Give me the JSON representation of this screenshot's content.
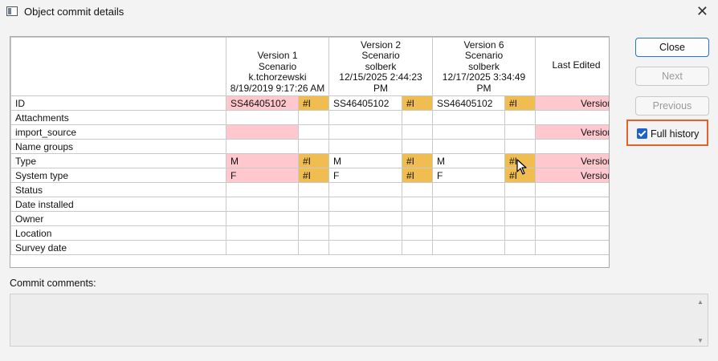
{
  "window": {
    "title": "Object commit details"
  },
  "grid": {
    "columns": [
      {
        "lines": [
          "Version 1",
          "Scenario",
          "k.tchorzewski",
          "8/19/2019 9:17:26 AM"
        ]
      },
      {
        "lines": [
          "Version 2",
          "Scenario",
          "solberk",
          "12/15/2025 2:44:23",
          "PM"
        ]
      },
      {
        "lines": [
          "Version 6",
          "Scenario",
          "solberk",
          "12/17/2025 3:34:49",
          "PM"
        ]
      },
      {
        "lines": [
          "Last Edited"
        ]
      }
    ],
    "rows": [
      {
        "label": "ID",
        "v1": "SS46405102",
        "v1f": "#I",
        "v2": "SS46405102",
        "v2f": "#I",
        "v6": "SS46405102",
        "v6f": "#I",
        "last": "Version"
      },
      {
        "label": "Attachments",
        "v1": "",
        "v1f": "",
        "v2": "",
        "v2f": "",
        "v6": "",
        "v6f": "",
        "last": ""
      },
      {
        "label": "import_source",
        "v1": "",
        "v1f": "",
        "v2": "",
        "v2f": "",
        "v6": "",
        "v6f": "",
        "last": "Version"
      },
      {
        "label": "Name groups",
        "v1": "",
        "v1f": "",
        "v2": "",
        "v2f": "",
        "v6": "",
        "v6f": "",
        "last": ""
      },
      {
        "label": "Type",
        "v1": "M",
        "v1f": "#I",
        "v2": "M",
        "v2f": "#I",
        "v6": "M",
        "v6f": "#I",
        "last": "Version"
      },
      {
        "label": "System type",
        "v1": "F",
        "v1f": "#I",
        "v2": "F",
        "v2f": "#I",
        "v6": "F",
        "v6f": "#I",
        "last": "Version"
      },
      {
        "label": "Status",
        "v1": "",
        "v1f": "",
        "v2": "",
        "v2f": "",
        "v6": "",
        "v6f": "",
        "last": ""
      },
      {
        "label": "Date installed",
        "v1": "",
        "v1f": "",
        "v2": "",
        "v2f": "",
        "v6": "",
        "v6f": "",
        "last": ""
      },
      {
        "label": "Owner",
        "v1": "",
        "v1f": "",
        "v2": "",
        "v2f": "",
        "v6": "",
        "v6f": "",
        "last": ""
      },
      {
        "label": "Location",
        "v1": "",
        "v1f": "",
        "v2": "",
        "v2f": "",
        "v6": "",
        "v6f": "",
        "last": ""
      },
      {
        "label": "Survey date",
        "v1": "",
        "v1f": "",
        "v2": "",
        "v2f": "",
        "v6": "",
        "v6f": "",
        "last": ""
      }
    ]
  },
  "buttons": {
    "close": "Close",
    "next": "Next",
    "previous": "Previous"
  },
  "full_history": {
    "label": "Full history",
    "checked": true
  },
  "commit_comments": {
    "label": "Commit comments:",
    "value": ""
  },
  "colors": {
    "changed": "#ffc7ce",
    "flag": "#f0bd50",
    "accent": "#2a6fd1",
    "highlight": "#e8612c"
  }
}
